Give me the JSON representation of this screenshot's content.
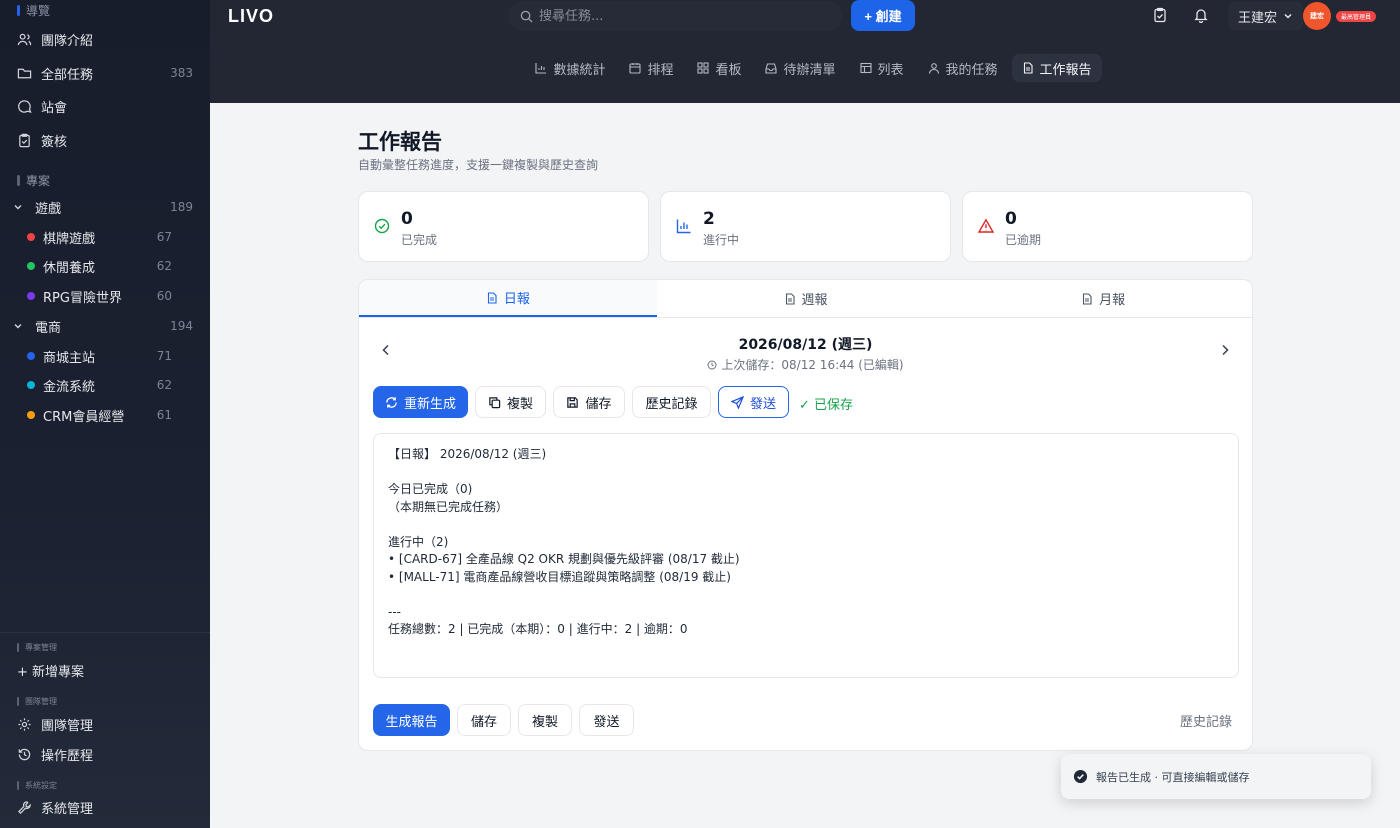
{
  "sidebar": {
    "nav_header": "導覽",
    "nav": [
      {
        "label": "團隊介紹",
        "icon": "users-icon"
      },
      {
        "label": "全部任務",
        "icon": "folder-icon",
        "count": "383"
      },
      {
        "label": "站會",
        "icon": "chat-icon"
      },
      {
        "label": "簽核",
        "icon": "clipboard-check-icon"
      }
    ],
    "projects_header": "專案",
    "groups": [
      {
        "label": "遊戲",
        "count": "189",
        "items": [
          {
            "label": "棋牌遊戲",
            "count": "67",
            "color": "#ef4444"
          },
          {
            "label": "休閒養成",
            "count": "62",
            "color": "#22c55e"
          },
          {
            "label": "RPG冒險世界",
            "count": "60",
            "color": "#7c3aed"
          }
        ]
      },
      {
        "label": "電商",
        "count": "194",
        "items": [
          {
            "label": "商城主站",
            "count": "71",
            "color": "#2563eb"
          },
          {
            "label": "金流系統",
            "count": "62",
            "color": "#06b6d4"
          },
          {
            "label": "CRM會員經營",
            "count": "61",
            "color": "#f59e0b"
          }
        ]
      }
    ],
    "project_mgmt_header": "專案管理",
    "add_project": "+ 新增專案",
    "team_mgmt_header": "團隊管理",
    "team_mgmt": "團隊管理",
    "op_history": "操作歷程",
    "sys_header": "系統設定",
    "sys_mgmt": "系統管理"
  },
  "topbar": {
    "logo": "LIVO",
    "search_placeholder": "搜尋任務...",
    "create_label": "+ 創建",
    "user_name": "王建宏",
    "avatar_text": "建宏",
    "role_badge": "最高管理員",
    "view_tabs": [
      {
        "label": "數據統計",
        "icon": "bar-chart-icon"
      },
      {
        "label": "排程",
        "icon": "calendar-icon"
      },
      {
        "label": "看板",
        "icon": "kanban-icon"
      },
      {
        "label": "待辦清單",
        "icon": "inbox-icon"
      },
      {
        "label": "列表",
        "icon": "table-icon"
      },
      {
        "label": "我的任務",
        "icon": "user-icon"
      },
      {
        "label": "工作報告",
        "icon": "document-icon",
        "active": true
      }
    ]
  },
  "page": {
    "title": "工作報告",
    "subtitle": "自動彙整任務進度，支援一鍵複製與歷史查詢"
  },
  "stats": [
    {
      "value": "0",
      "label": "已完成",
      "icon": "check-circle-icon",
      "color": "#16a34a"
    },
    {
      "value": "2",
      "label": "進行中",
      "icon": "bar-chart-icon",
      "color": "#2563eb"
    },
    {
      "value": "0",
      "label": "已逾期",
      "icon": "warning-icon",
      "color": "#dc2626"
    }
  ],
  "report_tabs": [
    {
      "label": "日報",
      "active": true
    },
    {
      "label": "週報"
    },
    {
      "label": "月報"
    }
  ],
  "report": {
    "date": "2026/08/12 (週三)",
    "last_saved": "上次儲存：08/12 16:44 (已編輯)",
    "actions": {
      "regenerate": "重新生成",
      "copy": "複製",
      "save": "儲存",
      "history": "歷史記錄",
      "send": "發送"
    },
    "saved_status": "✓ 已保存",
    "content": "【日報】 2026/08/12 (週三)\n\n今日已完成（0)\n（本期無已完成任務）\n\n進行中（2)\n• [CARD-67] 全產品線 Q2 OKR 規劃與優先級評審 (08/17 截止)\n• [MALL-71] 電商產品線營收目標追蹤與策略調整 (08/19 截止)\n\n---\n任務總數：2 | 已完成（本期）：0 | 進行中：2 | 逾期：0",
    "bottom": {
      "generate": "生成報告",
      "save": "儲存",
      "copy": "複製",
      "send": "發送",
      "history": "歷史記錄"
    }
  },
  "toast": {
    "message": "報告已生成 · 可直接編輯或儲存"
  }
}
